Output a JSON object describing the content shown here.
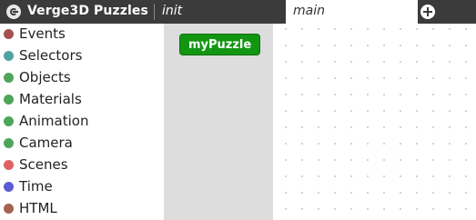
{
  "app": {
    "title": "Verge3D Puzzles",
    "logo_icon": "verge3d-logo-icon"
  },
  "tabs": [
    {
      "label": "init",
      "active": false
    },
    {
      "label": "main",
      "active": true
    }
  ],
  "add_tab_icon": "plus-circle-icon",
  "toolbox": {
    "categories": [
      {
        "label": "Events",
        "color": "#a5504f"
      },
      {
        "label": "Selectors",
        "color": "#4fa5a5"
      },
      {
        "label": "Objects",
        "color": "#4fa55b"
      },
      {
        "label": "Materials",
        "color": "#4fa55b"
      },
      {
        "label": "Animation",
        "color": "#4fa55b"
      },
      {
        "label": "Camera",
        "color": "#4fa55b"
      },
      {
        "label": "Scenes",
        "color": "#e06060"
      },
      {
        "label": "Time",
        "color": "#5b5bd6"
      },
      {
        "label": "HTML",
        "color": "#a5634f"
      }
    ]
  },
  "flyout": {
    "block_label": "myPuzzle",
    "block_color": "#129612"
  }
}
